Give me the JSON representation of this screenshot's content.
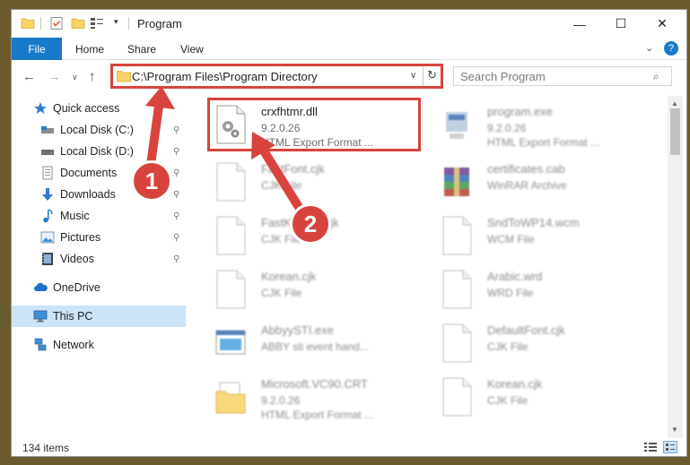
{
  "window": {
    "title": "Program",
    "min_glyph": "—",
    "max_glyph": "☐",
    "close_glyph": "✕"
  },
  "ribbon": {
    "file_label": "File",
    "home_label": "Home",
    "share_label": "Share",
    "view_label": "View",
    "collapse_glyph": "⌄",
    "help_glyph": "?"
  },
  "nav": {
    "back_glyph": "←",
    "forward_glyph": "→",
    "recent_glyph": "∨",
    "up_glyph": "↑"
  },
  "address": {
    "path": "C:\\Program Files\\Program Directory",
    "dropdown_glyph": "∨",
    "refresh_glyph": "↻"
  },
  "search": {
    "placeholder": "Search Program",
    "icon_glyph": "⌕"
  },
  "sidebar": {
    "items": [
      {
        "label": "Quick access",
        "icon": "star-icon"
      },
      {
        "label": "Local Disk (C:)",
        "icon": "drive-icon",
        "pinned": true
      },
      {
        "label": "Local Disk (D:)",
        "icon": "drive-icon",
        "pinned": true
      },
      {
        "label": "Documents",
        "icon": "documents-icon",
        "pinned": true
      },
      {
        "label": "Downloads",
        "icon": "download-icon",
        "pinned": true
      },
      {
        "label": "Music",
        "icon": "music-icon",
        "pinned": true
      },
      {
        "label": "Pictures",
        "icon": "pictures-icon",
        "pinned": true
      },
      {
        "label": "Videos",
        "icon": "videos-icon",
        "pinned": true
      },
      {
        "label": "OneDrive",
        "icon": "cloud-icon"
      },
      {
        "label": "This PC",
        "icon": "computer-icon",
        "selected": true
      },
      {
        "label": "Network",
        "icon": "network-icon"
      }
    ],
    "pin_glyph": "📌"
  },
  "files": [
    {
      "name": "crxfhtmr.dll",
      "line1": "9.2.0.26",
      "line2": "HTML Export Format ...",
      "icon": "dll-gear-icon",
      "highlighted": true
    },
    {
      "name": "program.exe",
      "line1": "9.2.0.26",
      "line2": "HTML Export Format ...",
      "icon": "exe-icon"
    },
    {
      "name": "FastFont.cjk",
      "line1": "CJK File",
      "line2": "",
      "icon": "blank-file-icon"
    },
    {
      "name": "certificates.cab",
      "line1": "WinRAR Archive",
      "line2": "",
      "icon": "winrar-icon"
    },
    {
      "name": "FastKorean.cjk",
      "line1": "CJK File",
      "line2": "",
      "icon": "blank-file-icon"
    },
    {
      "name": "SndToWP14.wcm",
      "line1": "WCM File",
      "line2": "",
      "icon": "blank-file-icon"
    },
    {
      "name": "Korean.cjk",
      "line1": "CJK File",
      "line2": "",
      "icon": "blank-file-icon"
    },
    {
      "name": "Arabic.wrd",
      "line1": "WRD File",
      "line2": "",
      "icon": "blank-file-icon"
    },
    {
      "name": "AbbyySTI.exe",
      "line1": "ABBY sti event hand...",
      "line2": "",
      "icon": "app-window-icon"
    },
    {
      "name": "DefaultFont.cjk",
      "line1": "CJK File",
      "line2": "",
      "icon": "blank-file-icon"
    },
    {
      "name": "Microsoft.VC90.CRT",
      "line1": "9.2.0.26",
      "line2": "HTML Export Format ...",
      "icon": "folder-doc-icon"
    },
    {
      "name": "Korean.cjk",
      "line1": "CJK File",
      "line2": "",
      "icon": "blank-file-icon"
    }
  ],
  "status": {
    "item_count": "134 items"
  },
  "callouts": {
    "step1": "1",
    "step2": "2"
  },
  "colors": {
    "accent": "#1979ca",
    "highlight": "#d8443d",
    "selected": "#cce4f7"
  }
}
